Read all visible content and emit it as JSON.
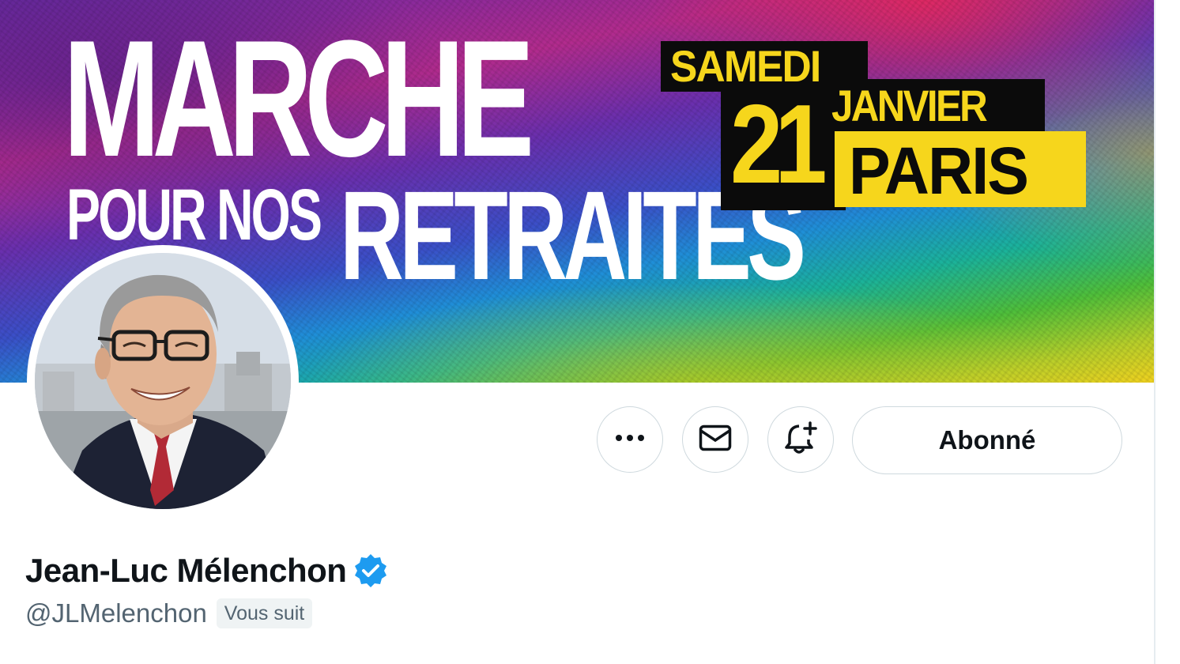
{
  "banner": {
    "headline_line1": "MARCHE",
    "headline_line2a": "POUR NOS",
    "headline_line2b": "RETRAITES",
    "date_weekday": "SAMEDI",
    "date_day": "21",
    "date_month": "JANVIER",
    "date_city": "PARIS",
    "colors": {
      "text": "#ffffff",
      "date_yellow": "#f6d61c",
      "date_black": "#0b0b0b"
    }
  },
  "avatar": {
    "alt_icon": "profile-photo"
  },
  "actions": {
    "more_icon": "more-horizontal-icon",
    "message_icon": "envelope-icon",
    "notify_icon": "bell-plus-icon",
    "follow_label": "Abonné"
  },
  "profile": {
    "display_name": "Jean-Luc Mélenchon",
    "verified_icon": "verified-badge-icon",
    "verified_color": "#1d9bf0",
    "handle": "@JLMelenchon",
    "follows_you_label": "Vous suit"
  }
}
